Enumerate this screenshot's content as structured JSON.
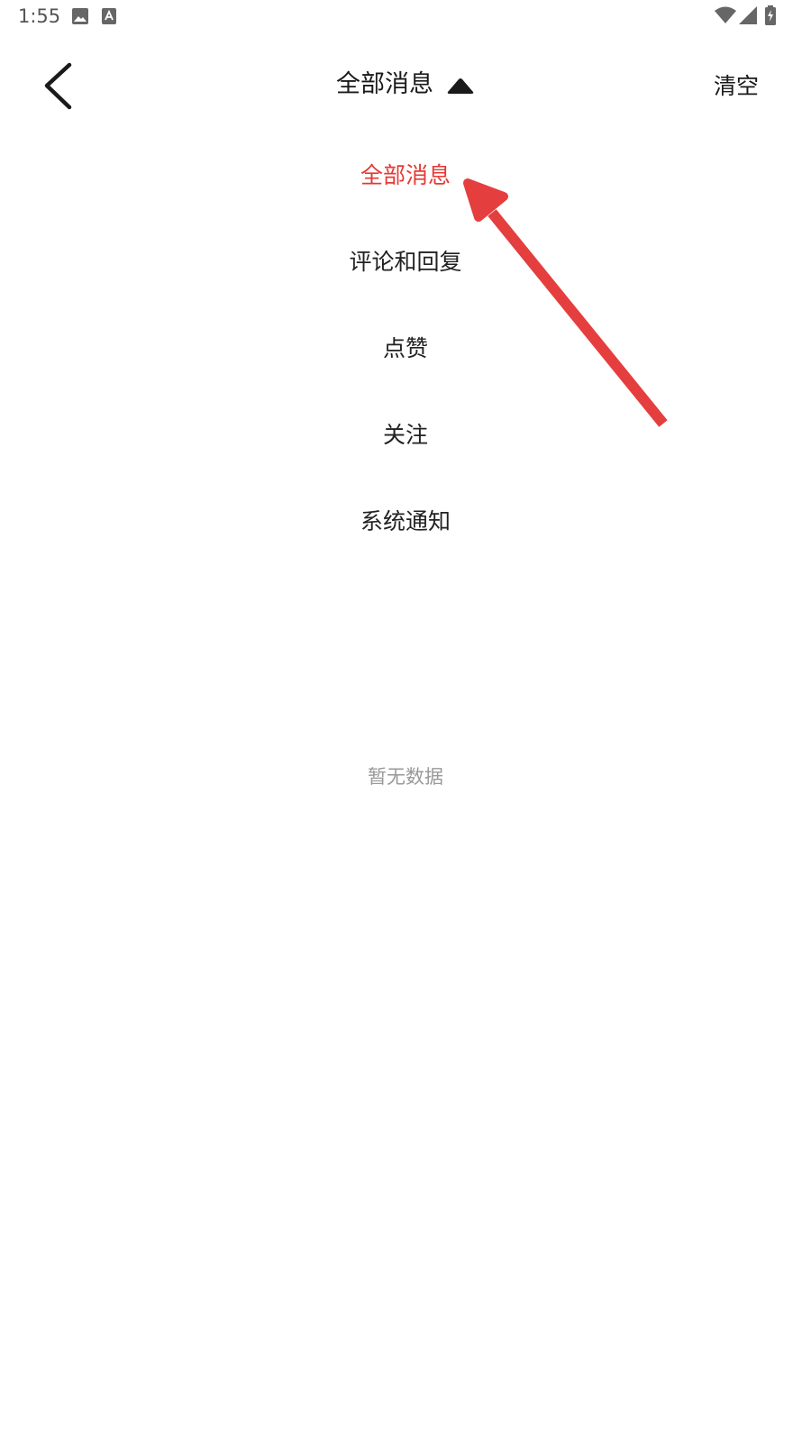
{
  "status_bar": {
    "time": "1:55",
    "icons": [
      "image-icon",
      "translate-icon",
      "wifi-icon",
      "signal-icon",
      "battery-charging-icon"
    ]
  },
  "header": {
    "back_icon": "chevron-left-icon",
    "title": "全部消息",
    "caret_icon": "caret-up-icon",
    "clear_label": "清空"
  },
  "filter_menu": {
    "items": [
      {
        "label": "全部消息",
        "active": true
      },
      {
        "label": "评论和回复",
        "active": false
      },
      {
        "label": "点赞",
        "active": false
      },
      {
        "label": "关注",
        "active": false
      },
      {
        "label": "系统通知",
        "active": false
      }
    ]
  },
  "empty_state": {
    "text": "暂无数据"
  },
  "colors": {
    "accent": "#e53935",
    "text": "#222222",
    "muted": "#999999",
    "annotation_arrow": "#e53e3e"
  }
}
